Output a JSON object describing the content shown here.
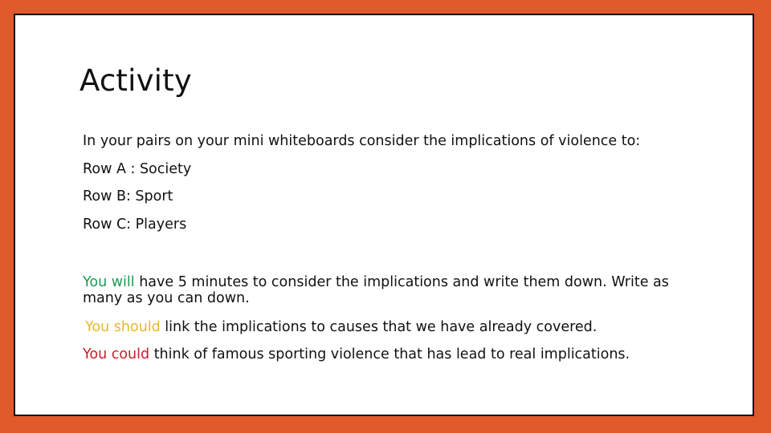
{
  "slide": {
    "title": "Activity",
    "intro": "In your pairs on your mini whiteboards consider the implications of violence to:",
    "rows": [
      "Row A : Society",
      "Row B: Sport",
      "Row C: Players"
    ],
    "tasks": [
      {
        "lead": "You will",
        "rest": " have 5 minutes to consider the implications and write them down. Write as many as you can down.",
        "color": "#1E9A55"
      },
      {
        "lead": "You should",
        "rest": " link the implications to causes that we have already covered.",
        "color": "#E8B830"
      },
      {
        "lead": "You could",
        "rest": " think of famous sporting violence that has lead to real implications.",
        "color": "#C0202A"
      }
    ]
  },
  "colors": {
    "frame": "#E05A2B",
    "background": "#FFFFFF"
  }
}
